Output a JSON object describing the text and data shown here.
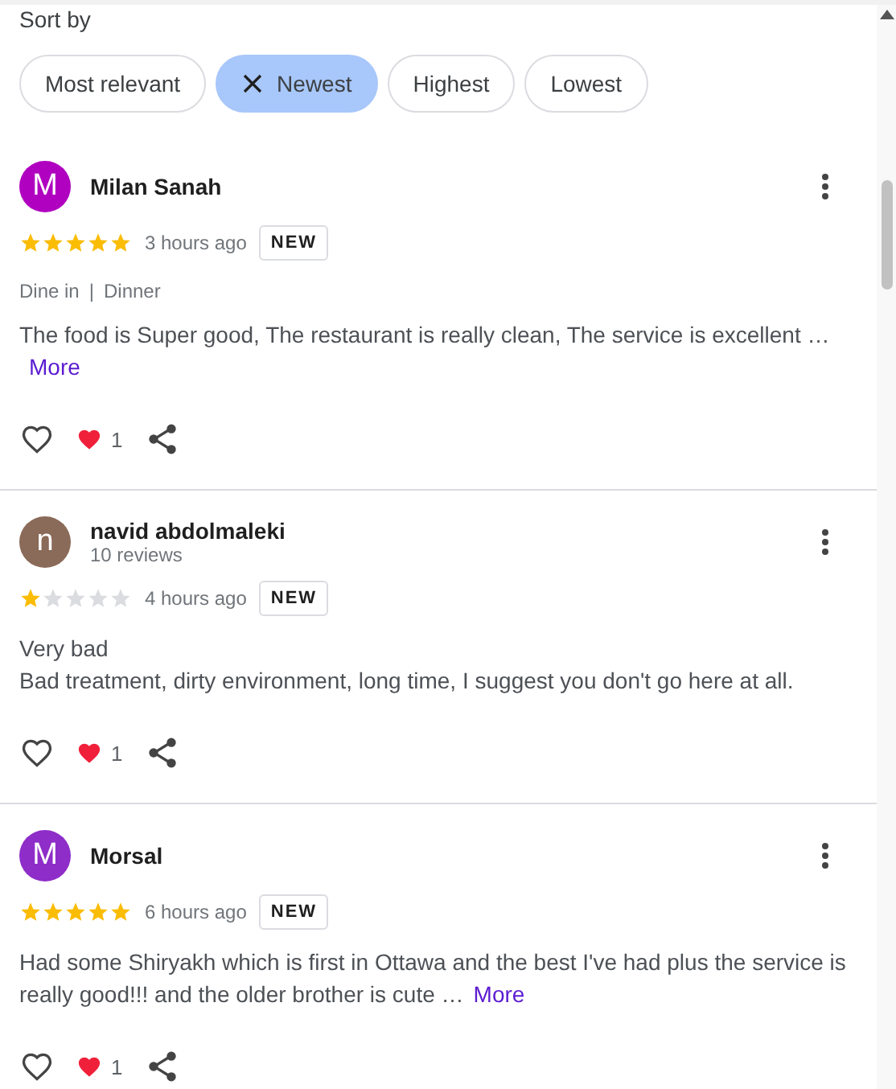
{
  "sort_label": "Sort by",
  "sort_chips": [
    {
      "label": "Most relevant",
      "selected": false
    },
    {
      "label": "Newest",
      "selected": true
    },
    {
      "label": "Highest",
      "selected": false
    },
    {
      "label": "Lowest",
      "selected": false
    }
  ],
  "reviews": [
    {
      "initial": "M",
      "color": "#b000c0",
      "name": "Milan Sanah",
      "stars": 5,
      "time": "3 hours ago",
      "badge": "NEW",
      "meta": [
        "Dine in",
        "|",
        "Dinner"
      ],
      "text": "The food is Super good, The restaurant is really clean, The service is excellent …",
      "more": "More",
      "reactions": "1"
    },
    {
      "initial": "n",
      "color": "#8a6a58",
      "name": "navid abdolmaleki",
      "subtitle": "10 reviews",
      "stars": 1,
      "time": "4 hours ago",
      "badge": "NEW",
      "lines": [
        "Very bad",
        "Bad treatment, dirty environment, long time, I suggest you don't go here at all."
      ],
      "reactions": "1"
    },
    {
      "initial": "M",
      "color": "#8e2dc8",
      "name": "Morsal",
      "stars": 5,
      "time": "6 hours ago",
      "badge": "NEW",
      "text": "Had some Shiryakh which is first in Ottawa and the best I've had plus the service is really good!!! and the older brother is cute …",
      "more": "More",
      "reactions": "1"
    }
  ]
}
